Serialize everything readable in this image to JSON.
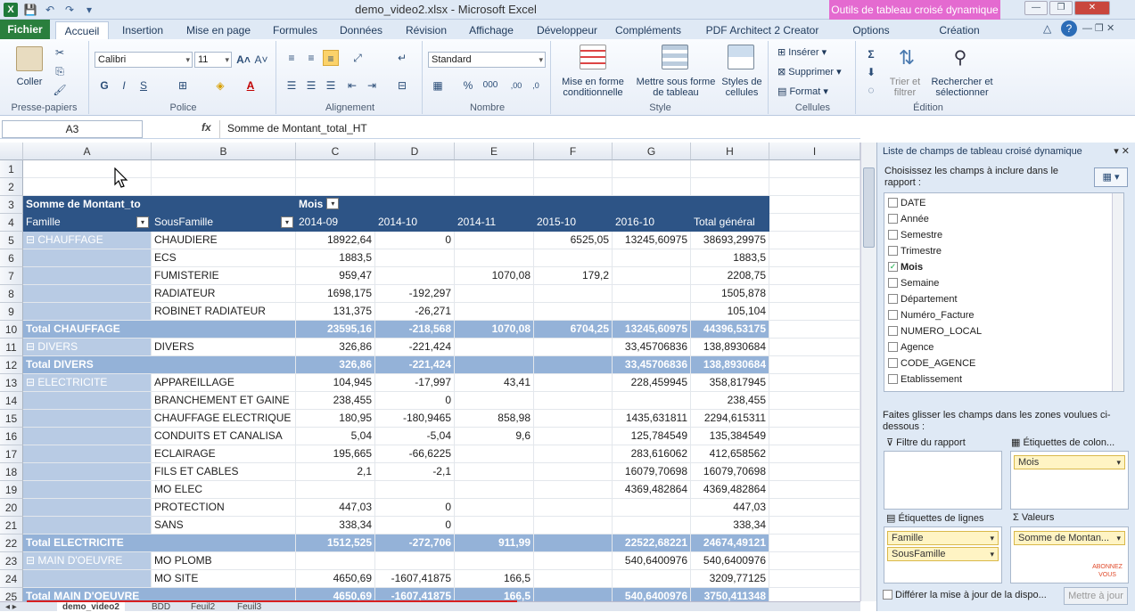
{
  "window": {
    "title": "demo_video2.xlsx - Microsoft Excel",
    "context_tools": "Outils de tableau croisé dynamique",
    "app_icon": "X"
  },
  "tabs": [
    "Fichier",
    "Accueil",
    "Insertion",
    "Mise en page",
    "Formules",
    "Données",
    "Révision",
    "Affichage",
    "Développeur",
    "Compléments",
    "PDF Architect 2 Creator",
    "Options",
    "Création"
  ],
  "ribbon": {
    "clipboard": {
      "label": "Presse-papiers",
      "paste": "Coller"
    },
    "font": {
      "label": "Police",
      "name": "Calibri",
      "size": "11",
      "bold": "G",
      "italic": "I",
      "underline": "S"
    },
    "alignment": {
      "label": "Alignement"
    },
    "number": {
      "label": "Nombre",
      "format": "Standard",
      "percent": "%",
      "thousands": "000"
    },
    "style": {
      "label": "Style",
      "conditional": "Mise en forme conditionnelle",
      "table": "Mettre sous forme de tableau",
      "cell_styles": "Styles de cellules"
    },
    "cells": {
      "label": "Cellules",
      "insert": "Insérer",
      "delete": "Supprimer",
      "format": "Format"
    },
    "editing": {
      "label": "Édition",
      "sort": "Trier et filtrer",
      "find": "Rechercher et sélectionner",
      "sigma": "Σ"
    }
  },
  "formula_bar": {
    "name_box": "A3",
    "fx": "fx",
    "formula": "Somme de Montant_total_HT"
  },
  "grid": {
    "columns": [
      "A",
      "B",
      "C",
      "D",
      "E",
      "F",
      "G",
      "H",
      "I"
    ],
    "rows": [
      "1",
      "2",
      "3",
      "4",
      "5",
      "6",
      "7",
      "8",
      "9",
      "10",
      "11",
      "12",
      "13",
      "14",
      "15",
      "16",
      "17",
      "18",
      "19",
      "20",
      "21",
      "22",
      "23",
      "24",
      "25"
    ],
    "pivot_header": {
      "values_label": "Somme de Montant_to",
      "columns_label": "Mois",
      "famille": "Famille",
      "sousfamille": "SousFamille",
      "months": [
        "2014-09",
        "2014-10",
        "2014-11",
        "2015-10",
        "2016-10"
      ],
      "grand_total": "Total général"
    },
    "data_rows": [
      {
        "kind": "fam",
        "fam": "⊟ CHAUFFAGE",
        "sub": "CHAUDIERE",
        "v": [
          "18922,64",
          "0",
          "",
          "6525,05",
          "13245,60975",
          "38693,29975"
        ]
      },
      {
        "kind": "fam",
        "fam": "",
        "sub": "ECS",
        "v": [
          "1883,5",
          "",
          "",
          "",
          "",
          "1883,5"
        ]
      },
      {
        "kind": "fam",
        "fam": "",
        "sub": "FUMISTERIE",
        "v": [
          "959,47",
          "",
          "1070,08",
          "179,2",
          "",
          "2208,75"
        ]
      },
      {
        "kind": "fam",
        "fam": "",
        "sub": "RADIATEUR",
        "v": [
          "1698,175",
          "-192,297",
          "",
          "",
          "",
          "1505,878"
        ]
      },
      {
        "kind": "fam",
        "fam": "",
        "sub": "ROBINET RADIATEUR",
        "v": [
          "131,375",
          "-26,271",
          "",
          "",
          "",
          "105,104"
        ]
      },
      {
        "kind": "tot",
        "fam": "Total CHAUFFAGE",
        "sub": "",
        "v": [
          "23595,16",
          "-218,568",
          "1070,08",
          "6704,25",
          "13245,60975",
          "44396,53175"
        ]
      },
      {
        "kind": "fam",
        "fam": "⊟ DIVERS",
        "sub": "DIVERS",
        "v": [
          "326,86",
          "-221,424",
          "",
          "",
          "33,45706836",
          "138,8930684"
        ]
      },
      {
        "kind": "tot",
        "fam": "Total DIVERS",
        "sub": "",
        "v": [
          "326,86",
          "-221,424",
          "",
          "",
          "33,45706836",
          "138,8930684"
        ]
      },
      {
        "kind": "fam",
        "fam": "⊟ ELECTRICITE",
        "sub": "APPAREILLAGE",
        "v": [
          "104,945",
          "-17,997",
          "43,41",
          "",
          "228,459945",
          "358,817945"
        ]
      },
      {
        "kind": "fam",
        "fam": "",
        "sub": "BRANCHEMENT ET GAINE",
        "v": [
          "238,455",
          "0",
          "",
          "",
          "",
          "238,455"
        ]
      },
      {
        "kind": "fam",
        "fam": "",
        "sub": "CHAUFFAGE ELECTRIQUE",
        "v": [
          "180,95",
          "-180,9465",
          "858,98",
          "",
          "1435,631811",
          "2294,615311"
        ]
      },
      {
        "kind": "fam",
        "fam": "",
        "sub": "CONDUITS ET CANALISA",
        "v": [
          "5,04",
          "-5,04",
          "9,6",
          "",
          "125,784549",
          "135,384549"
        ]
      },
      {
        "kind": "fam",
        "fam": "",
        "sub": "ECLAIRAGE",
        "v": [
          "195,665",
          "-66,6225",
          "",
          "",
          "283,616062",
          "412,658562"
        ]
      },
      {
        "kind": "fam",
        "fam": "",
        "sub": "FILS ET CABLES",
        "v": [
          "2,1",
          "-2,1",
          "",
          "",
          "16079,70698",
          "16079,70698"
        ]
      },
      {
        "kind": "fam",
        "fam": "",
        "sub": "MO ELEC",
        "v": [
          "",
          "",
          "",
          "",
          "4369,482864",
          "4369,482864"
        ]
      },
      {
        "kind": "fam",
        "fam": "",
        "sub": "PROTECTION",
        "v": [
          "447,03",
          "0",
          "",
          "",
          "",
          "447,03"
        ]
      },
      {
        "kind": "fam",
        "fam": "",
        "sub": "SANS",
        "v": [
          "338,34",
          "0",
          "",
          "",
          "",
          "338,34"
        ]
      },
      {
        "kind": "tot",
        "fam": "Total ELECTRICITE",
        "sub": "",
        "v": [
          "1512,525",
          "-272,706",
          "911,99",
          "",
          "22522,68221",
          "24674,49121"
        ]
      },
      {
        "kind": "fam",
        "fam": "⊟ MAIN D'OEUVRE",
        "sub": "MO PLOMB",
        "v": [
          "",
          "",
          "",
          "",
          "540,6400976",
          "540,6400976"
        ]
      },
      {
        "kind": "fam",
        "fam": "",
        "sub": "MO SITE",
        "v": [
          "4650,69",
          "-1607,41875",
          "166,5",
          "",
          "",
          "3209,77125"
        ]
      },
      {
        "kind": "tot",
        "fam": "Total MAIN D'OEUVRE",
        "sub": "",
        "v": [
          "4650,69",
          "-1607,41875",
          "166,5",
          "",
          "540,6400976",
          "3750,411348"
        ]
      }
    ],
    "sheets": [
      "demo_video2",
      "BDD",
      "Feuil2",
      "Feuil3"
    ]
  },
  "pivot_pane": {
    "title": "Liste de champs de tableau croisé dynamique",
    "choose": "Choisissez les champs à inclure dans le rapport :",
    "fields": [
      {
        "name": "DATE",
        "checked": false
      },
      {
        "name": "Année",
        "checked": false
      },
      {
        "name": "Semestre",
        "checked": false
      },
      {
        "name": "Trimestre",
        "checked": false
      },
      {
        "name": "Mois",
        "checked": true
      },
      {
        "name": "Semaine",
        "checked": false
      },
      {
        "name": "Département",
        "checked": false
      },
      {
        "name": "Numéro_Facture",
        "checked": false
      },
      {
        "name": "NUMERO_LOCAL",
        "checked": false
      },
      {
        "name": "Agence",
        "checked": false
      },
      {
        "name": "CODE_AGENCE",
        "checked": false
      },
      {
        "name": "Etablissement",
        "checked": false
      }
    ],
    "drag_hint": "Faites glisser les champs dans les zones voulues ci-dessous :",
    "zone_filter": "Filtre du rapport",
    "zone_columns": "Étiquettes de colon...",
    "zone_rows": "Étiquettes de lignes",
    "zone_values": "Valeurs",
    "col_items": [
      "Mois"
    ],
    "row_items": [
      "Famille",
      "SousFamille"
    ],
    "value_items": [
      "Somme de Montan..."
    ],
    "defer": "Différer la mise à jour de la dispo...",
    "update": "Mettre à jour",
    "watermark": "ABONNEZ VOUS"
  }
}
